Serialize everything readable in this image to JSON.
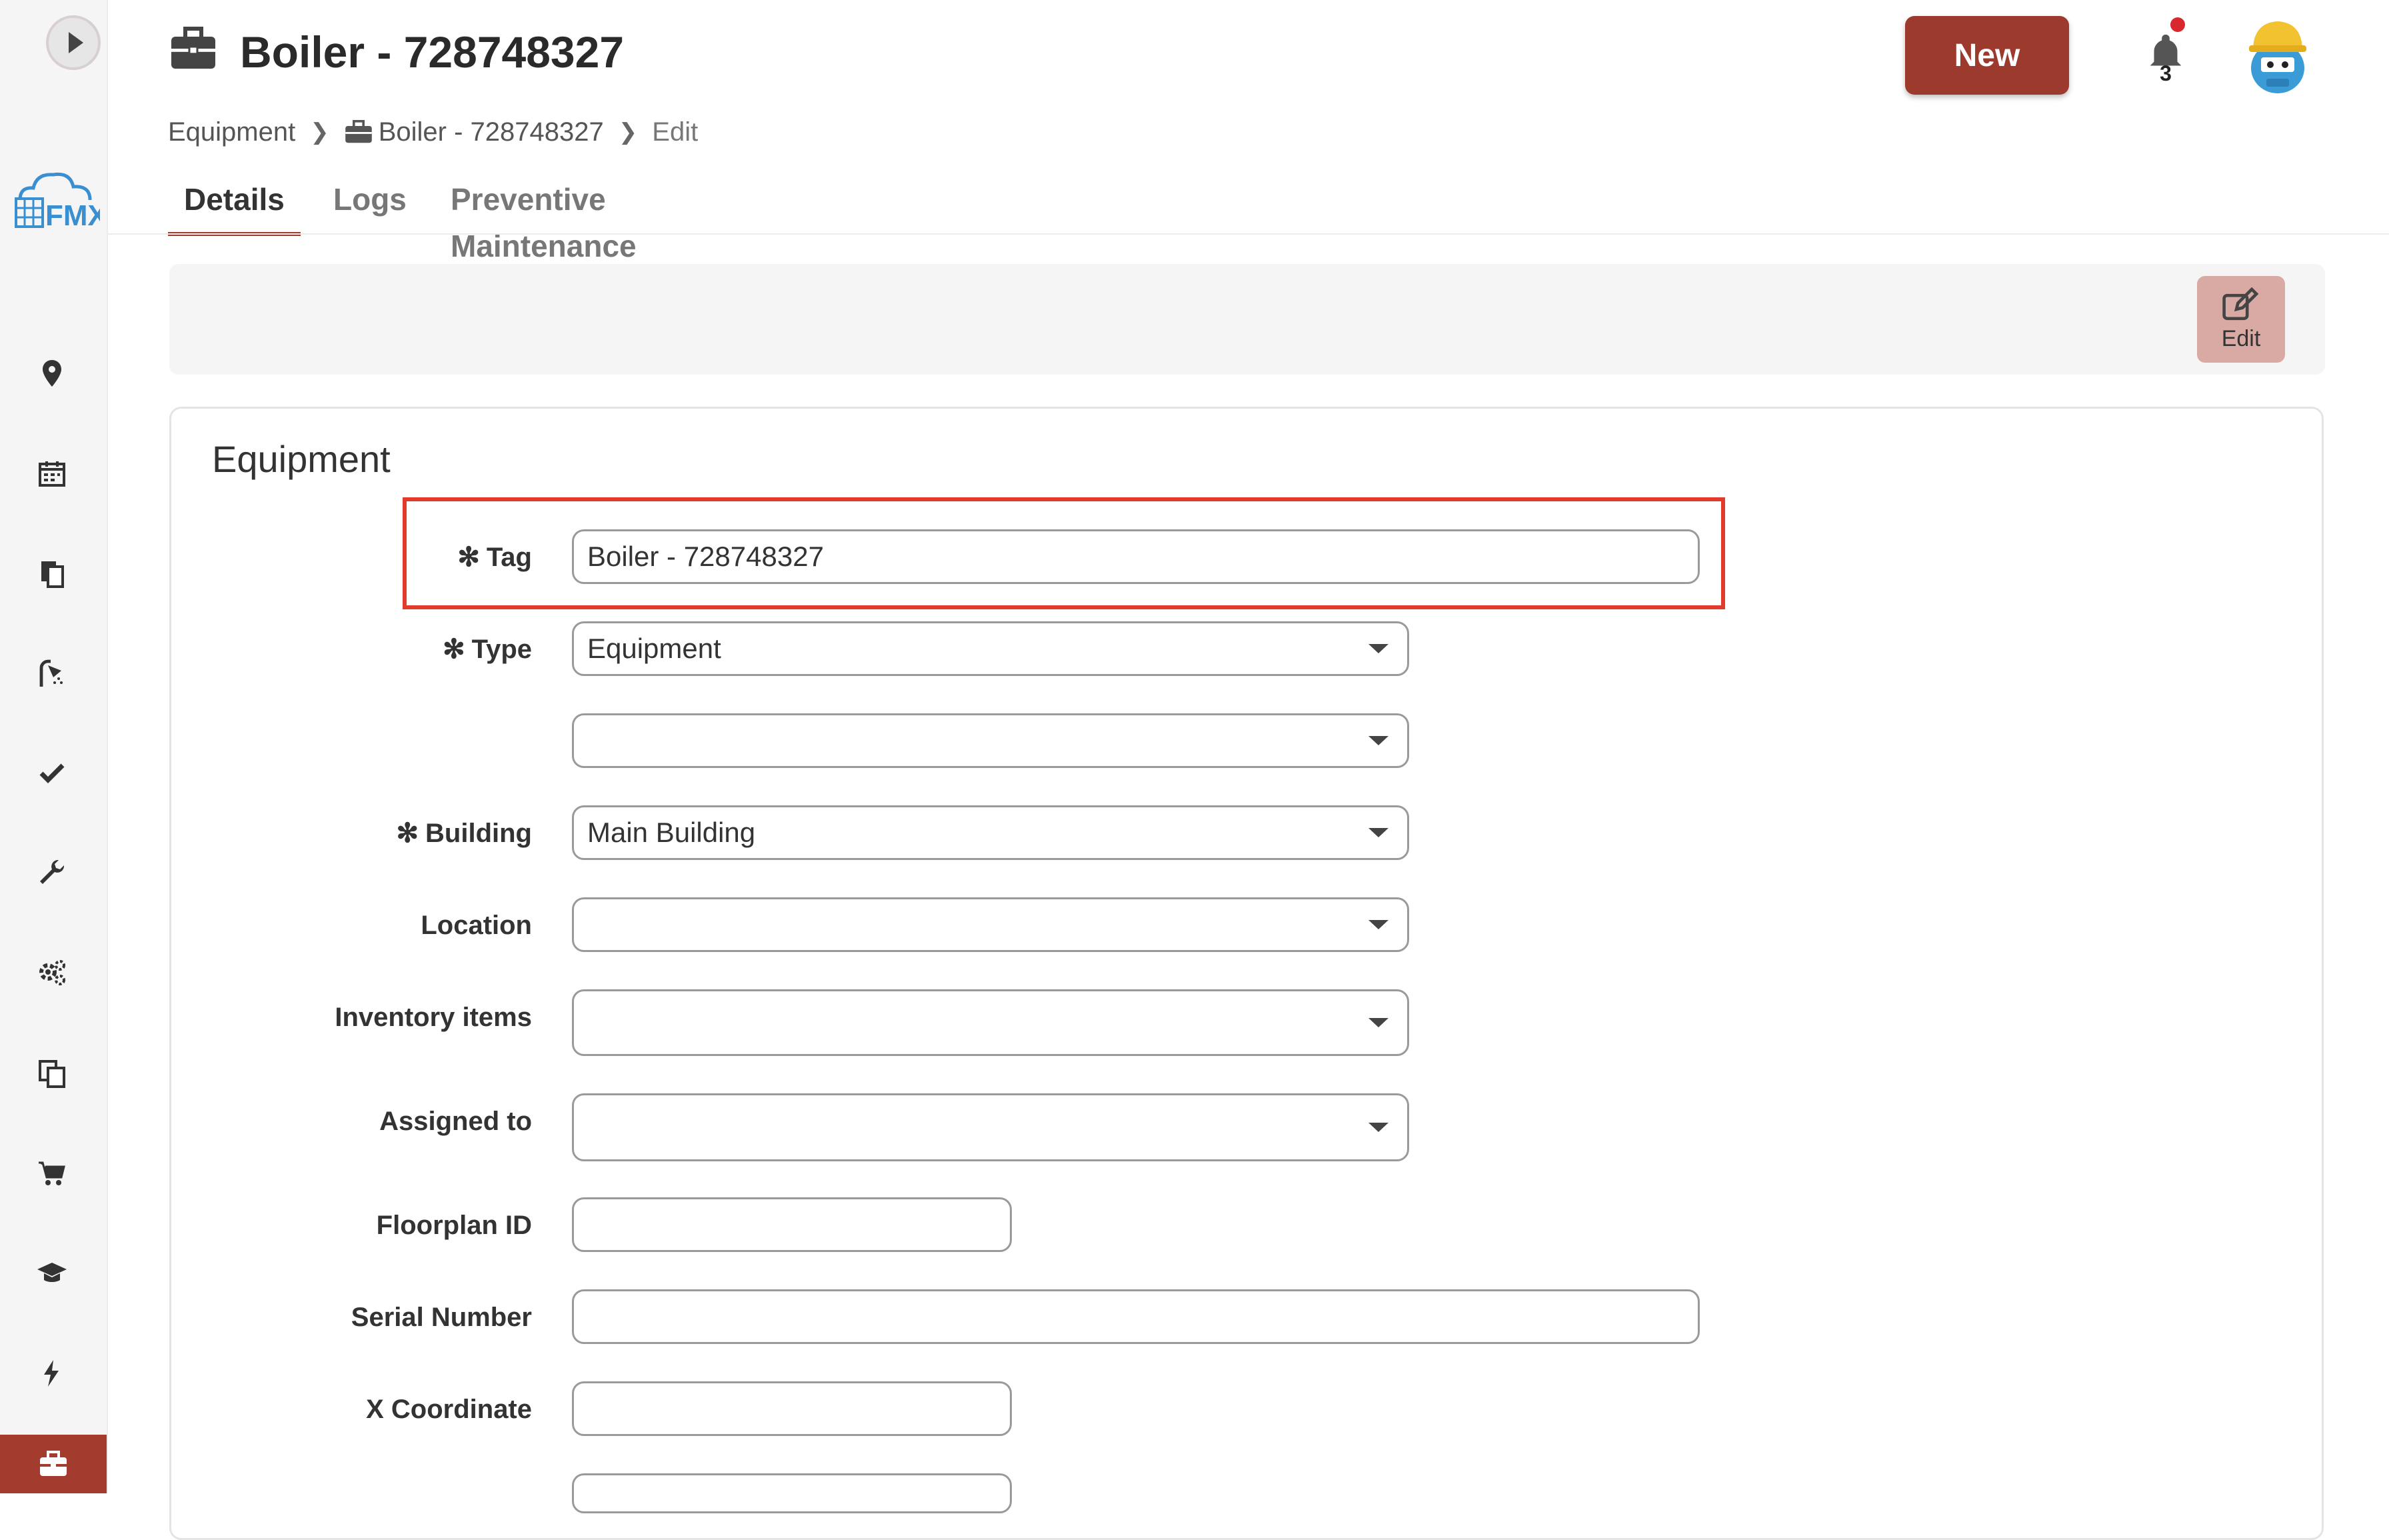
{
  "header": {
    "title": "Boiler - 728748327",
    "new_label": "New",
    "notification_count": "3"
  },
  "breadcrumb": {
    "items": [
      "Equipment",
      "Boiler - 728748327",
      "Edit"
    ]
  },
  "tabs": [
    {
      "label": "Details",
      "active": true
    },
    {
      "label": "Logs",
      "active": false
    },
    {
      "label": "Preventive Maintenance",
      "active": false
    }
  ],
  "toolbar": {
    "edit_label": "Edit"
  },
  "form": {
    "section_title": "Equipment",
    "fields": {
      "tag": {
        "label": "Tag",
        "value": "Boiler - 728748327",
        "required": true
      },
      "type": {
        "label": "Type",
        "value": "Equipment",
        "required": true
      },
      "subtype": {
        "label": "",
        "value": ""
      },
      "building": {
        "label": "Building",
        "value": "Main Building",
        "required": true
      },
      "location": {
        "label": "Location",
        "value": ""
      },
      "inventory_items": {
        "label": "Inventory items",
        "value": ""
      },
      "assigned_to": {
        "label": "Assigned to",
        "value": ""
      },
      "floorplan_id": {
        "label": "Floorplan ID",
        "value": ""
      },
      "serial_number": {
        "label": "Serial Number",
        "value": ""
      },
      "x_coordinate": {
        "label": "X Coordinate",
        "value": ""
      }
    }
  },
  "colors": {
    "accent": "#a33b2e",
    "highlight": "#e03b2c"
  },
  "sidebar_icons": [
    "map-pin-icon",
    "calendar-icon",
    "documents-icon",
    "shower-icon",
    "checkmark-icon",
    "wrench-icon",
    "gears-icon",
    "copy-icon",
    "cart-icon",
    "graduation-cap-icon",
    "lightning-icon",
    "briefcase-icon"
  ]
}
